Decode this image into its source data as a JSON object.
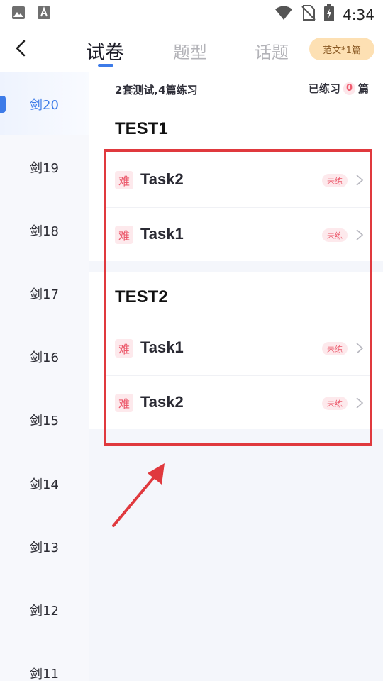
{
  "status_bar": {
    "time": "4:34",
    "icons": [
      "image-icon",
      "font-a-icon",
      "wifi-icon",
      "no-sim-icon",
      "battery-charging-icon"
    ]
  },
  "header": {
    "tabs": [
      {
        "label": "试卷",
        "active": true
      },
      {
        "label": "题型",
        "active": false
      },
      {
        "label": "话题",
        "active": false
      }
    ],
    "sample_essay_label": "范文*1篇"
  },
  "sidebar": {
    "items": [
      {
        "label": "剑20",
        "active": true
      },
      {
        "label": "剑19",
        "active": false
      },
      {
        "label": "剑18",
        "active": false
      },
      {
        "label": "剑17",
        "active": false
      },
      {
        "label": "剑16",
        "active": false
      },
      {
        "label": "剑15",
        "active": false
      },
      {
        "label": "剑14",
        "active": false
      },
      {
        "label": "剑13",
        "active": false
      },
      {
        "label": "剑12",
        "active": false
      },
      {
        "label": "剑11",
        "active": false
      }
    ]
  },
  "summary": {
    "left": "2套测试,4篇练习",
    "practiced_prefix": "已练习",
    "practiced_count": "0",
    "practiced_suffix": "篇"
  },
  "tests": [
    {
      "title": "TEST1",
      "tasks": [
        {
          "difficulty": "难",
          "name": "Task2",
          "status": "未练"
        },
        {
          "difficulty": "难",
          "name": "Task1",
          "status": "未练"
        }
      ]
    },
    {
      "title": "TEST2",
      "tasks": [
        {
          "difficulty": "难",
          "name": "Task1",
          "status": "未练"
        },
        {
          "difficulty": "难",
          "name": "Task2",
          "status": "未练"
        }
      ]
    }
  ],
  "colors": {
    "accent": "#3d7be8",
    "difficulty": "#ec5a6c",
    "annotation": "#e0393e",
    "sample_pill_bg": "#fde0b3"
  }
}
